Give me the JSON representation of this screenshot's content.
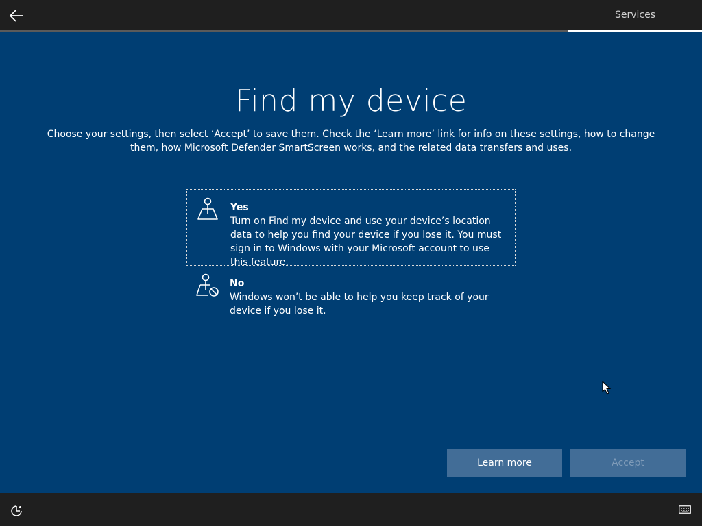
{
  "header": {
    "back_icon": "arrow-left-icon",
    "tab_label": "Services"
  },
  "page": {
    "title": "Find my device",
    "subtitle": "Choose your settings, then select ‘Accept’ to save them. Check the ‘Learn more’ link for info on these settings, how to change them, how Microsoft Defender SmartScreen works, and the related data transfers and uses."
  },
  "options": [
    {
      "label": "Yes",
      "description": "Turn on Find my device and use your device’s location data to help you find your device if you lose it. You must sign in to Windows with your Microsoft account to use this feature.",
      "icon": "map-pin-icon",
      "selected": true
    },
    {
      "label": "No",
      "description": "Windows won’t be able to help you keep track of your device if you lose it.",
      "icon": "map-pin-blocked-icon",
      "selected": false
    }
  ],
  "buttons": {
    "learn_more": "Learn more",
    "accept": "Accept"
  },
  "footer": {
    "accessibility_icon": "ease-of-access-icon",
    "keyboard_icon": "keyboard-icon"
  },
  "colors": {
    "background": "#003e73",
    "bars": "#1f1f1f",
    "button": "#426d97"
  }
}
